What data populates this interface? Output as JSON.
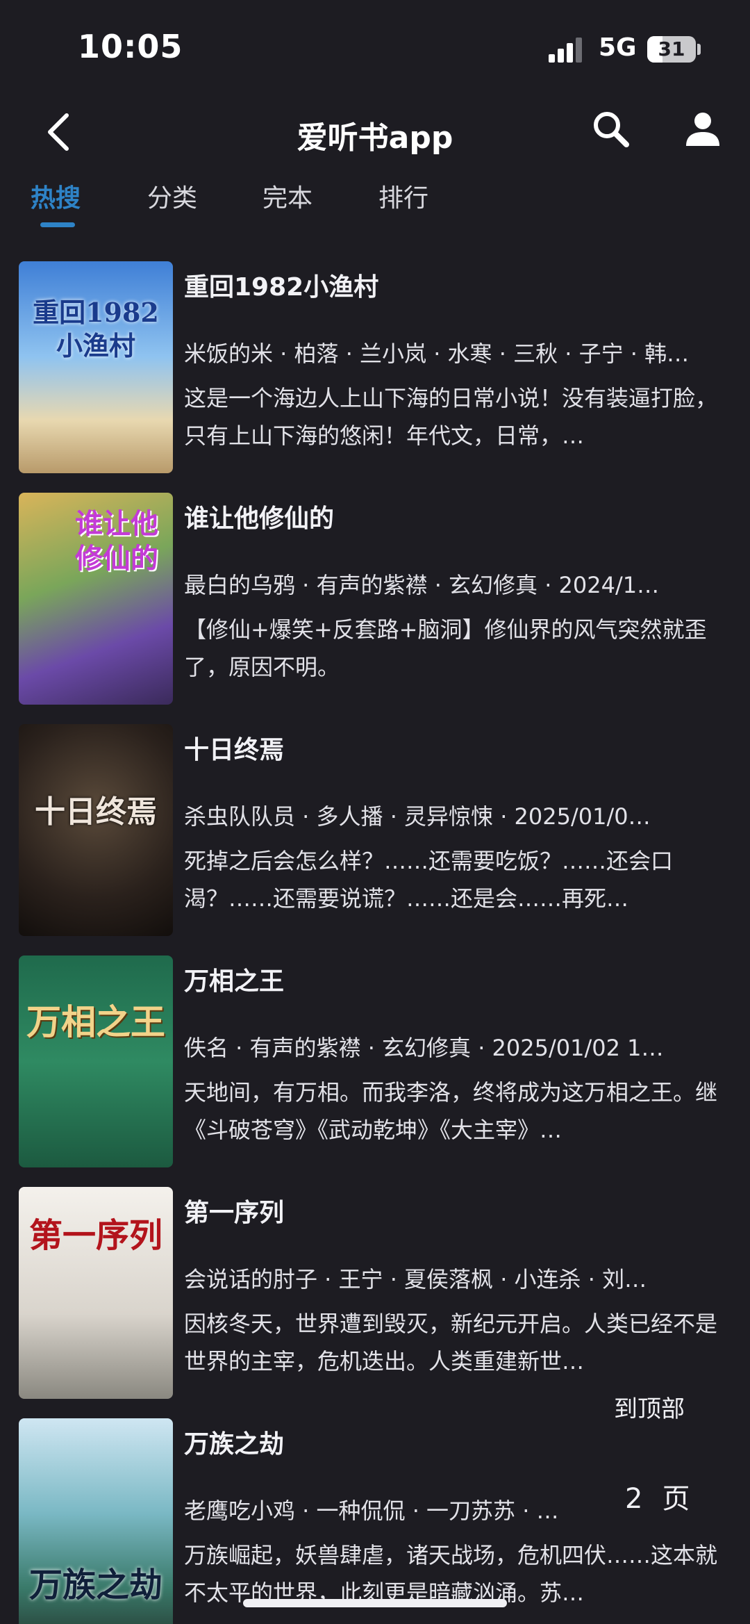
{
  "status": {
    "time": "10:05",
    "network": "5G",
    "battery": "31"
  },
  "appbar": {
    "title": "爱听书app"
  },
  "tabs": [
    {
      "label": "热搜",
      "active": true
    },
    {
      "label": "分类",
      "active": false
    },
    {
      "label": "完本",
      "active": false
    },
    {
      "label": "排行",
      "active": false
    }
  ],
  "books": [
    {
      "title": "重回1982小渔村",
      "meta": "米饭的米 · 柏落 · 兰小岚 · 水寒 · 三秋 · 子宁 · 韩…",
      "desc": "这是一个海边人上山下海的日常小说！没有装逼打脸，只有上山下海的悠闲！年代文，日常，…",
      "cover_text": "重回1982 小渔村"
    },
    {
      "title": "谁让他修仙的",
      "meta": "最白的乌鸦 · 有声的紫襟 · 玄幻修真 · 2024/1…",
      "desc": "【修仙+爆笑+反套路+脑洞】修仙界的风气突然就歪了，原因不明。",
      "cover_text": "谁让他 修仙的"
    },
    {
      "title": "十日终焉",
      "meta": "杀虫队队员 · 多人播 · 灵异惊悚 · 2025/01/0…",
      "desc": "死掉之后会怎么样？……还需要吃饭？……还会口渴？……还需要说谎？……还是会……再死…",
      "cover_text": "十日终焉"
    },
    {
      "title": "万相之王",
      "meta": "佚名 · 有声的紫襟 · 玄幻修真 · 2025/01/02 1…",
      "desc": "天地间，有万相。而我李洛，终将成为这万相之王。继《斗破苍穹》《武动乾坤》《大主宰》…",
      "cover_text": "万相之王"
    },
    {
      "title": "第一序列",
      "meta": "会说话的肘子 · 王宁 · 夏侯落枫 · 小连杀 · 刘…",
      "desc": "因核冬天，世界遭到毁灭，新纪元开启。人类已经不是世界的主宰，危机迭出。人类重建新世…",
      "cover_text": "第一序列"
    },
    {
      "title": "万族之劫",
      "meta": "老鹰吃小鸡 · 一种侃侃 · 一刀苏苏 · …",
      "desc": "万族崛起，妖兽肆虐，诸天战场，危机四伏……这本就不太平的世界，此刻更是暗藏汹涌。苏…",
      "cover_text": "万族之劫"
    }
  ],
  "floating": {
    "to_top": "到顶部",
    "page_number": "2",
    "page_unit": "页"
  },
  "colors": {
    "background": "#1d1c22",
    "accent": "#2e83c7"
  }
}
